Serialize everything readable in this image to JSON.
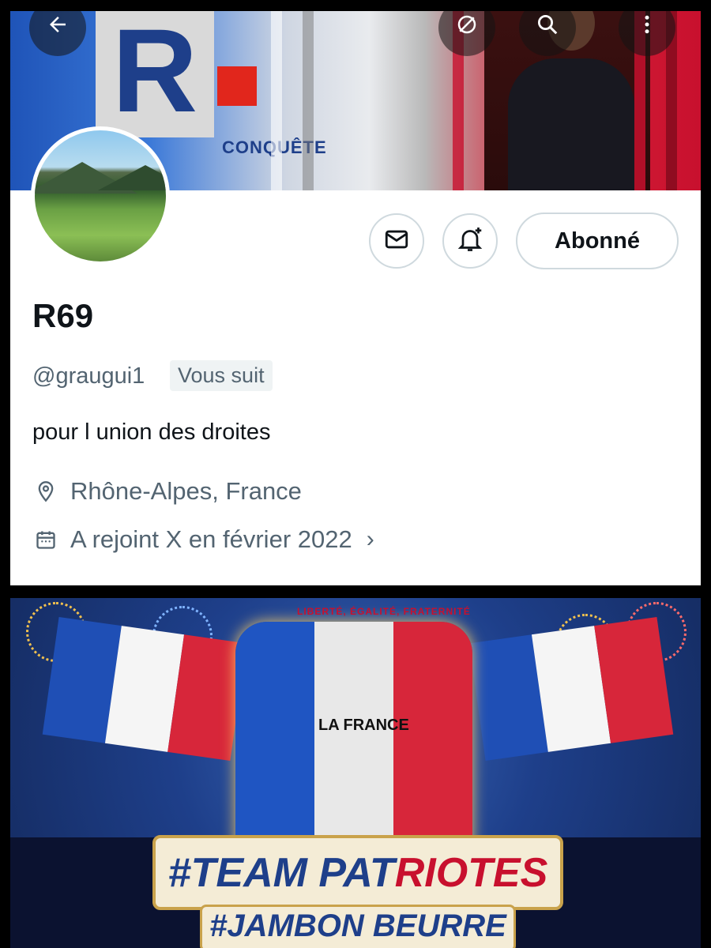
{
  "banner": {
    "logo_letter": "R",
    "tagline": "CONQUÊTE",
    "buttons": {
      "back_icon": "arrow-left-icon",
      "grok_icon": "grok-icon",
      "search_icon": "search-icon",
      "more_icon": "more-vertical-icon"
    }
  },
  "actions": {
    "message_icon": "mail-icon",
    "notify_icon": "bell-plus-icon",
    "follow_label": "Abonné"
  },
  "profile": {
    "name": "R69",
    "handle": "@graugui1",
    "follows_you": "Vous suit",
    "bio": "pour l union des droites",
    "location_icon": "location-pin-icon",
    "location": "Rhône-Alpes, France",
    "joined_icon": "calendar-icon",
    "joined": "A rejoint X en février 2022",
    "joined_chevron": "›"
  },
  "poster": {
    "motto": "LIBERTÉ, ÉGALITÉ, FRATERNITÉ",
    "map_label": "LA FRANCE",
    "hashtag_part1": "#TEAM PAT",
    "hashtag_part2": "RIOTES",
    "hashtag2": "#JAMBON BEURRE"
  },
  "colors": {
    "text_primary": "#0f1419",
    "text_secondary": "#536471",
    "border": "#cfd9de",
    "france_blue": "#1e3f8a",
    "france_red": "#c8102e"
  }
}
